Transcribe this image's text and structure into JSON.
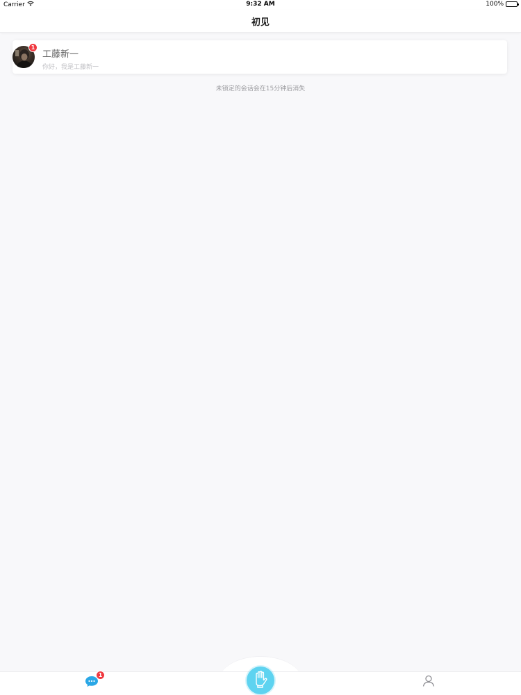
{
  "status_bar": {
    "carrier": "Carrier",
    "time": "9:32 AM",
    "battery": "100%"
  },
  "nav": {
    "title": "初见"
  },
  "conversations": [
    {
      "name": "工藤新一",
      "preview": "你好，我是工藤新一",
      "unread": "1"
    }
  ],
  "notice": "未锁定的会话会在15分钟后消失",
  "tab_bar": {
    "messages_badge": "1"
  },
  "colors": {
    "accent": "#5ed3f0",
    "badge": "#f0383f",
    "chat_icon": "#2aa7e6"
  }
}
